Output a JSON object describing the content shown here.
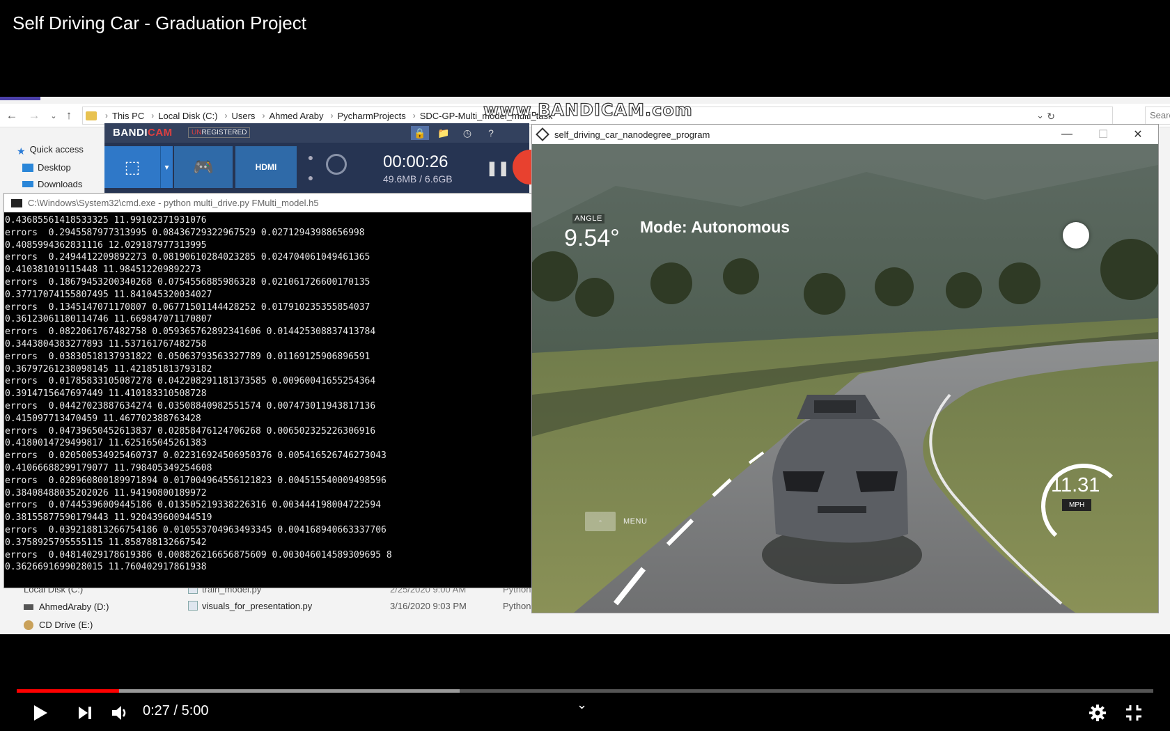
{
  "player": {
    "title": "Self Driving Car - Graduation Project",
    "current_time": "0:27",
    "time_separator": " / ",
    "duration": "5:00",
    "played_fraction": 0.09,
    "buffered_fraction": 0.39
  },
  "explorer": {
    "breadcrumbs": [
      "This PC",
      "Local Disk (C:)",
      "Users",
      "Ahmed Araby",
      "PycharmProjects",
      "SDC-GP-Multi_model_multi_task"
    ],
    "search_placeholder": "Searc",
    "sidebar": [
      "Quick access",
      "Desktop",
      "Downloads"
    ],
    "drives": [
      "Local Disk (C:)",
      "AhmedAraby (D:)",
      "CD Drive (E:)"
    ],
    "files": [
      {
        "name": "train_model.py",
        "date": "2/25/2020 9:00 AM",
        "type": "Python"
      },
      {
        "name": "visuals_for_presentation.py",
        "date": "3/16/2020 9:03 PM",
        "type": "Python"
      }
    ]
  },
  "watermark": "www.BANDICAM.com",
  "bandicam": {
    "logo_a": "BANDI",
    "logo_b": "CAM",
    "unreg_a": "UN",
    "unreg_b": "REGISTERED",
    "hdmi": "HDMI",
    "timer": "00:00:26",
    "size": "49.6MB / 6.6GB"
  },
  "cmd": {
    "title": "C:\\Windows\\System32\\cmd.exe - python  multi_drive.py FMulti_model.h5",
    "lines": [
      "0.43685561418533325 11.99102371931076",
      "errors  0.2945587977313995 0.08436729322967529 0.02712943988656998",
      "0.4085994362831116 12.029187977313995",
      "errors  0.2494412209892273 0.08190610284023285 0.024704061049461365",
      "0.410381019115448 11.984512209892273",
      "errors  0.18679453200340268 0.0754556885986328 0.021061726600170135",
      "0.37717074155807495 11.841045320034027",
      "errors  0.1345147071170807 0.06771501144428252 0.017910235355854037",
      "0.36123061180114746 11.669847071170807",
      "errors  0.0822061767482758 0.059365762892341606 0.014425308837413784",
      "0.3443804383277893 11.537161767482758",
      "errors  0.03830518137931822 0.05063793563327789 0.01169125906896591",
      "0.36797261238098145 11.421851813793182",
      "errors  0.01785833105087278 0.042208291181373585 0.00960041655254364",
      "0.3914715647697449 11.410183310508728",
      "errors  0.04427023887634274 0.03508840982551574 0.007473011943817136",
      "0.415097713470459 11.467702388763428",
      "errors  0.04739650452613837 0.02858476124706268 0.006502325226306916",
      "0.4180014729499817 11.625165045261383",
      "errors  0.020500534925460737 0.022316924506950376 0.005416526746273043",
      "0.41066688299179077 11.798405349254608",
      "errors  0.028960800189971894 0.017004964556121823 0.004515540009498596",
      "0.38408488035202026 11.94190800189972",
      "errors  0.07445396009445186 0.013505219338226316 0.003444198004722594",
      "0.38155877590179443 11.920439600944519",
      "errors  0.039218813266754186 0.010553704963493345 0.004168940663337706",
      "0.3758925795555115 11.858788132667542",
      "errors  0.04814029178619386 0.008826216656875609 0.003046014589309695 8",
      "0.3626691699028015 11.760402917861938"
    ]
  },
  "simulator": {
    "title": "self_driving_car_nanodegree_program",
    "angle_label": "ANGLE",
    "angle_value": "9.54°",
    "mode": "Mode: Autonomous",
    "speed": "11.31",
    "speed_unit": "MPH",
    "speed_fraction": 0.38,
    "menu_label": "MENU"
  },
  "colors": {
    "progress_played": "#ff0000",
    "bandicam_panel": "#263452",
    "record_button": "#e8412f"
  }
}
